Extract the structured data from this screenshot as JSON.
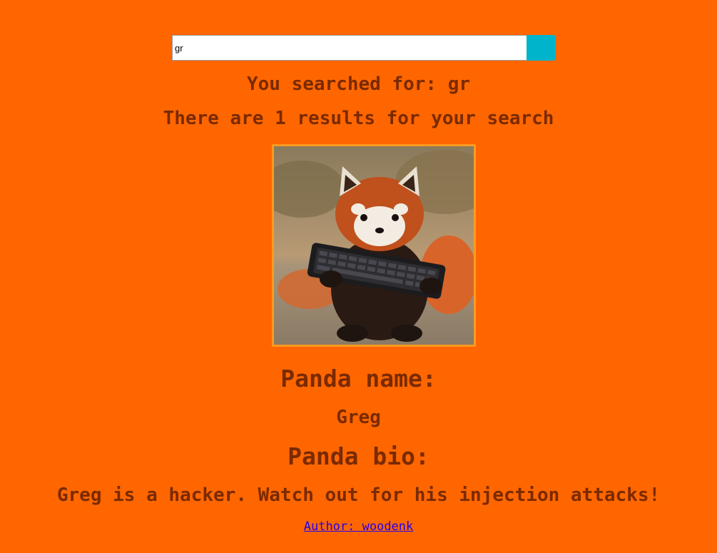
{
  "search": {
    "value": "gr",
    "button_label": ""
  },
  "results": {
    "searched_for": "You searched for: gr",
    "count_text": "There are 1 results for your search"
  },
  "panda": {
    "image_subject": "red panda holding a keyboard",
    "name_heading": "Panda name:",
    "name": "Greg",
    "bio_heading": "Panda bio:",
    "bio": "Greg is a hacker. Watch out for his injection attacks!",
    "author_link": "Author: woodenk"
  },
  "colors": {
    "page_background": "#ff6600",
    "text": "#7a2a00",
    "search_button": "#00b4cc",
    "image_border": "#ff9a1f",
    "link": "#2200ee"
  }
}
